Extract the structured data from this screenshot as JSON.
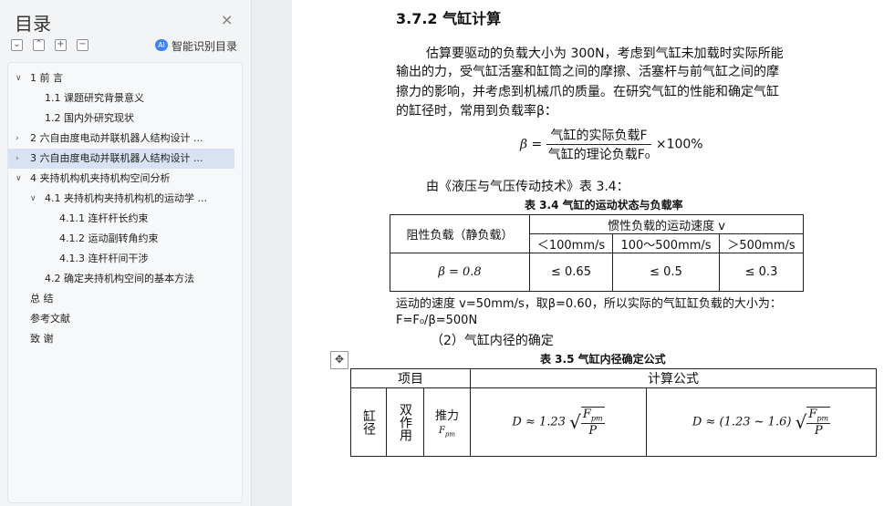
{
  "nav": {
    "title": "目录",
    "close_glyph": "×",
    "toolbar": {
      "collapse": "⌄",
      "expand": "⌃",
      "plus": "+",
      "minus": "−"
    },
    "ai_label": "智能识别目录",
    "items": [
      {
        "label": "1   前  言",
        "arrow": "∨"
      },
      {
        "label": "1.1  课题研究背景意义",
        "arrow": ""
      },
      {
        "label": "1.2  国内外研究现状",
        "arrow": ""
      },
      {
        "label": "2   六自由度电动并联机器人结构设计 ...",
        "arrow": "›"
      },
      {
        "label": "3   六自由度电动并联机器人结构设计 ...",
        "arrow": "›"
      },
      {
        "label": "4   夹持机构机夹持机构空间分析",
        "arrow": "∨"
      },
      {
        "label": "4.1 夹持机构夹持机构机的运动学 ...",
        "arrow": "∨"
      },
      {
        "label": "4.1.1  连杆杆长约束",
        "arrow": ""
      },
      {
        "label": "4.1.2  运动副转角约束",
        "arrow": ""
      },
      {
        "label": "4.1.3  连杆杆间干涉",
        "arrow": ""
      },
      {
        "label": "4.2  确定夹持机构空间的基本方法",
        "arrow": ""
      },
      {
        "label": "总   结",
        "arrow": ""
      },
      {
        "label": "参考文献",
        "arrow": ""
      },
      {
        "label": "致   谢",
        "arrow": ""
      }
    ]
  },
  "doc": {
    "heading": "3.7.2 气缸计算",
    "para1": [
      "估算要驱动的负载大小为 300N，考虑到气缸未加载时实际所能",
      "输出的力，受气缸活塞和缸筒之间的摩擦、活塞杆与前气缸之间的摩",
      "擦力的影响，并考虑到机械爪的质量。在研究气缸的性能和确定气缸",
      "的缸径时，常用到负载率β："
    ],
    "formula1": {
      "lhs": "β =",
      "num": "气缸的实际负载F",
      "den": "气缸的理论负载F₀",
      "tail": "×100%"
    },
    "ref_line": "由《液压与气压传动技术》表 3.4：",
    "table34": {
      "caption": "表 3.4  气缸的运动状态与负载率",
      "col1": "阻性负载（静负载）",
      "group": "惯性负载的运动速度 v",
      "sub": [
        "＜100mm/s",
        "100～500mm/s",
        "＞500mm/s"
      ],
      "row_label": "β = 0.8",
      "row_vals": [
        "≤ 0.65",
        "≤ 0.5",
        "≤ 0.3"
      ]
    },
    "speed_line": "运动的速度 v=50mm/s，取β=0.60，所以实际的气缸缸负载的大小为：",
    "force_line": "F=F₀/β=500N",
    "sub_heading": "（2）气缸内径的确定",
    "table35": {
      "caption": "表 3.5    气缸内径确定公式",
      "h1": "项目",
      "h2": "计算公式",
      "c1": "缸径",
      "c2": "双作用",
      "c3": "推力",
      "c3_sub": "F",
      "c3_subsub": "pm",
      "f1_lhs": "D ≈ 1.23",
      "f2_lhs": "D ≈ (1.23 ~ 1.6)",
      "f_num": "F",
      "f_num_sub": "pm",
      "f_den": "P"
    }
  }
}
